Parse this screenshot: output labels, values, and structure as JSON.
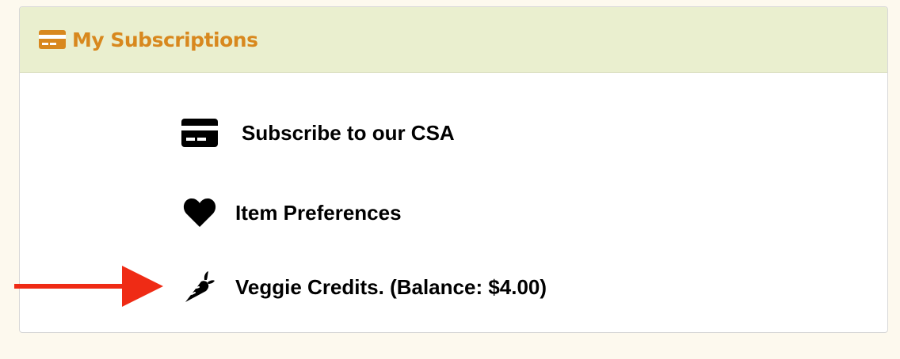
{
  "panel": {
    "title": "My Subscriptions",
    "title_icon": "credit-card-icon",
    "header_bg": "#eaefcf",
    "title_color": "#d8881e"
  },
  "items": [
    {
      "label": "Subscribe to our CSA",
      "icon": "credit-card-icon"
    },
    {
      "label": "Item Preferences",
      "icon": "heart-icon"
    },
    {
      "label": "Veggie Credits. (Balance: $4.00)",
      "icon": "carrot-icon"
    }
  ],
  "annotation": {
    "arrow_color": "#ef2b15",
    "arrow_icon": "right-arrow-icon"
  }
}
